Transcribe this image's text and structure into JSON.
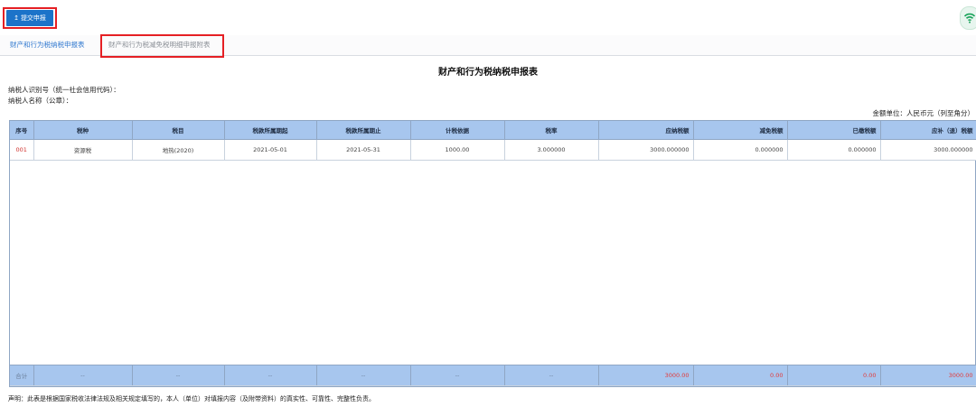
{
  "toolbar": {
    "submit_label": "提交申报",
    "submit_icon": "↥"
  },
  "tabs": [
    {
      "label": "财产和行为税纳税申报表"
    },
    {
      "label": "财产和行为税减免税明细申报附表"
    }
  ],
  "report": {
    "title": "财产和行为税纳税申报表",
    "taxpayer_id_label": "纳税人识别号（统一社会信用代码）：",
    "taxpayer_name_label": "纳税人名称（公章）：",
    "unit_label": "金额单位：人民币元（列至角分）"
  },
  "table": {
    "headers": [
      "序号",
      "税种",
      "税目",
      "税款所属期起",
      "税款所属期止",
      "计税依据",
      "税率",
      "应纳税额",
      "减免税额",
      "已缴税额",
      "应补（退）税额"
    ],
    "rows": [
      [
        "001",
        "资源税",
        "地热(2020)",
        "2021-05-01",
        "2021-05-31",
        "1000.00",
        "3.000000",
        "3000.000000",
        "0.000000",
        "0.000000",
        "3000.000000"
      ]
    ],
    "totals": [
      "合计",
      "--",
      "--",
      "--",
      "--",
      "--",
      "--",
      "3000.00",
      "0.00",
      "0.00",
      "3000.00"
    ]
  },
  "declaration": "声明：此表是根据国家税收法律法规及相关规定填写的，本人（单位）对填报内容（及附带资料）的真实性、可靠性、完整性负责。",
  "colors": {
    "accent": "#1c73c9",
    "highlight": "#e51f24",
    "header_bg": "#a7c6ee",
    "total_red": "#e23a3a"
  }
}
